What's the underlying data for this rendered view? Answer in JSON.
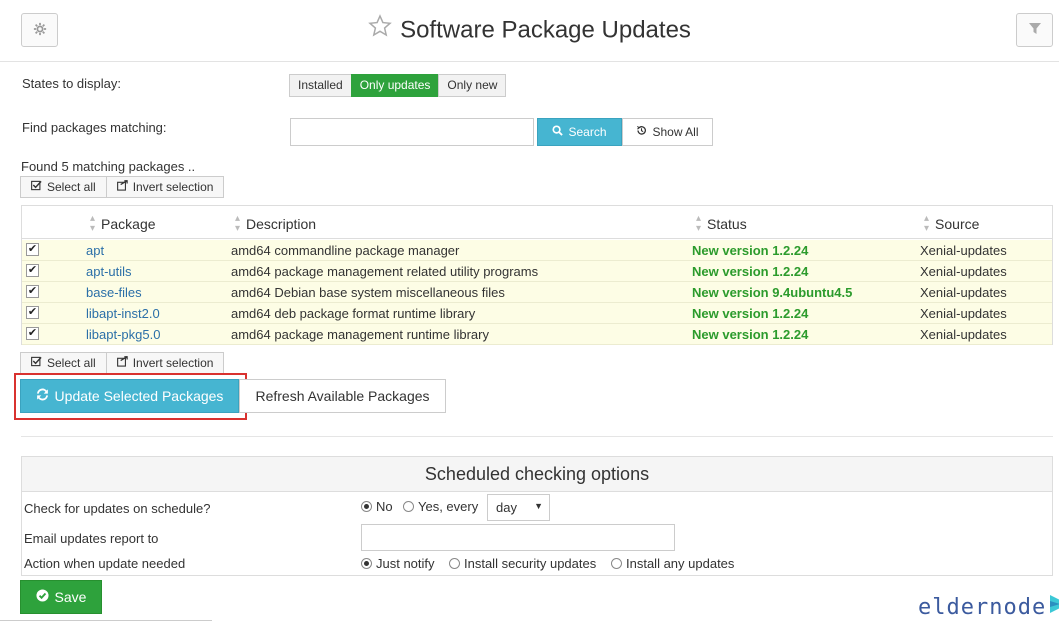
{
  "header": {
    "title": "Software Package Updates"
  },
  "filters": {
    "states_label": "States to display:",
    "states": [
      {
        "label": "Installed",
        "active": false
      },
      {
        "label": "Only updates",
        "active": true
      },
      {
        "label": "Only new",
        "active": false
      }
    ],
    "find_label": "Find packages matching:",
    "search_value": "",
    "search_button": "Search",
    "show_all_button": "Show All"
  },
  "results": {
    "found_text": "Found 5 matching packages ..",
    "select_all": "Select all",
    "invert_selection": "Invert selection",
    "columns": [
      "Package",
      "Description",
      "Status",
      "Source"
    ],
    "rows": [
      {
        "package": "apt",
        "description": "amd64 commandline package manager",
        "status": "New version 1.2.24",
        "source": "Xenial-updates",
        "checked": true
      },
      {
        "package": "apt-utils",
        "description": "amd64 package management related utility programs",
        "status": "New version 1.2.24",
        "source": "Xenial-updates",
        "checked": true
      },
      {
        "package": "base-files",
        "description": "amd64 Debian base system miscellaneous files",
        "status": "New version 9.4ubuntu4.5",
        "source": "Xenial-updates",
        "checked": true
      },
      {
        "package": "libapt-inst2.0",
        "description": "amd64 deb package format runtime library",
        "status": "New version 1.2.24",
        "source": "Xenial-updates",
        "checked": true
      },
      {
        "package": "libapt-pkg5.0",
        "description": "amd64 package management runtime library",
        "status": "New version 1.2.24",
        "source": "Xenial-updates",
        "checked": true
      }
    ]
  },
  "actions": {
    "update_selected": "Update Selected Packages",
    "refresh_available": "Refresh Available Packages"
  },
  "schedule": {
    "heading": "Scheduled checking options",
    "check_label": "Check for updates on schedule?",
    "check_no": "No",
    "check_yes": "Yes, every",
    "interval_value": "day",
    "email_label": "Email updates report to",
    "email_value": "",
    "action_label": "Action when update needed",
    "action_just_notify": "Just notify",
    "action_security": "Install security updates",
    "action_any": "Install any updates"
  },
  "save_button": "Save",
  "brand": {
    "text": "eldernode"
  },
  "colors": {
    "primary_blue": "#46b5d1",
    "success_green": "#2ea23c",
    "highlight_red": "#d9322f",
    "row_bg": "#fdfde5"
  }
}
